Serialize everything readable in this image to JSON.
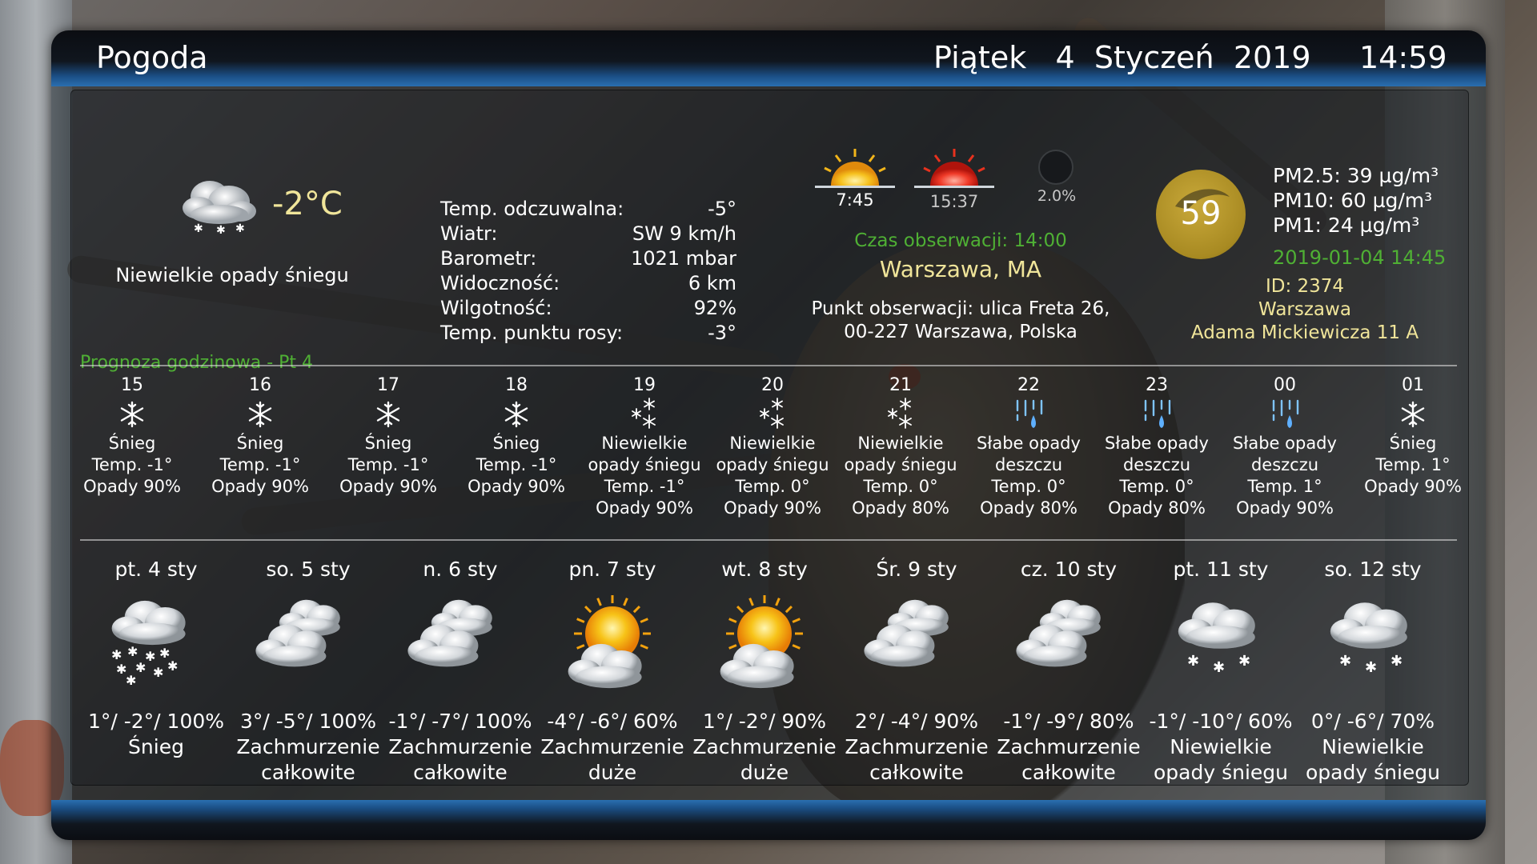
{
  "header": {
    "title": "Pogoda",
    "weekday": "Piątek",
    "day": "4",
    "month": "Styczeń",
    "year": "2019",
    "time": "14:59"
  },
  "current": {
    "icon": "snow-cloud-icon",
    "temperature": "-2°C",
    "description": "Niewielkie opady śniegu",
    "details": [
      {
        "label": "Temp. odczuwalna:",
        "value": "-5°"
      },
      {
        "label": "Wiatr:",
        "value": "SW 9 km/h"
      },
      {
        "label": "Barometr:",
        "value": "1021 mbar"
      },
      {
        "label": "Widoczność:",
        "value": "6 km"
      },
      {
        "label": "Wilgotność:",
        "value": "92%"
      },
      {
        "label": "Temp. punktu rosy:",
        "value": "-3°"
      }
    ]
  },
  "sun_moon": {
    "sunrise": "7:45",
    "sunset": "15:37",
    "moon": "2.0%"
  },
  "observation": {
    "time": "Czas obserwacji: 14:00",
    "city": "Warszawa, MA",
    "point_line1": "Punkt obserwacji: ulica Freta 26,",
    "point_line2": "00-227 Warszawa, Polska"
  },
  "air_quality": {
    "aqi": "59",
    "pm25": "PM2.5: 39 µg/m³",
    "pm10": "PM10: 60 µg/m³",
    "pm1": "PM1: 24 µg/m³",
    "updated": "2019-01-04  14:45",
    "station_id": "ID: 2374",
    "station_city": "Warszawa",
    "station_address": "Adama Mickiewicza 11 A",
    "accent_color": "#b8982a"
  },
  "hourly": {
    "title": "Prognoza godzinowa - Pt 4",
    "items": [
      {
        "hour": "15",
        "icon": "snowflake-icon",
        "desc": "Śnieg",
        "temp": "Temp. -1°",
        "precip": "Opady 90%"
      },
      {
        "hour": "16",
        "icon": "snowflake-icon",
        "desc": "Śnieg",
        "temp": "Temp. -1°",
        "precip": "Opady 90%"
      },
      {
        "hour": "17",
        "icon": "snowflake-icon",
        "desc": "Śnieg",
        "temp": "Temp. -1°",
        "precip": "Opady 90%"
      },
      {
        "hour": "18",
        "icon": "snowflake-icon",
        "desc": "Śnieg",
        "temp": "Temp. -1°",
        "precip": "Opady 90%"
      },
      {
        "hour": "19",
        "icon": "light-snow-icon",
        "desc": "Niewielkie opady śniegu",
        "temp": "Temp. -1°",
        "precip": "Opady 90%"
      },
      {
        "hour": "20",
        "icon": "light-snow-icon",
        "desc": "Niewielkie opady śniegu",
        "temp": "Temp. 0°",
        "precip": "Opady 90%"
      },
      {
        "hour": "21",
        "icon": "light-snow-icon",
        "desc": "Niewielkie opady śniegu",
        "temp": "Temp. 0°",
        "precip": "Opady 80%"
      },
      {
        "hour": "22",
        "icon": "rain-icon",
        "desc": "Słabe opady deszczu",
        "temp": "Temp. 0°",
        "precip": "Opady 80%"
      },
      {
        "hour": "23",
        "icon": "rain-icon",
        "desc": "Słabe opady deszczu",
        "temp": "Temp. 0°",
        "precip": "Opady 80%"
      },
      {
        "hour": "00",
        "icon": "rain-icon",
        "desc": "Słabe opady deszczu",
        "temp": "Temp. 1°",
        "precip": "Opady 90%"
      },
      {
        "hour": "01",
        "icon": "snowflake-icon",
        "desc": "Śnieg",
        "temp": "Temp. 1°",
        "precip": "Opady 90%"
      }
    ]
  },
  "daily": [
    {
      "day": "pt. 4 sty",
      "icon": "snow-cloud-icon",
      "temps": "1°/ -2°/ 100%",
      "desc1": "Śnieg",
      "desc2": ""
    },
    {
      "day": "so. 5 sty",
      "icon": "overcast-icon",
      "temps": "3°/ -5°/ 100%",
      "desc1": "Zachmurzenie",
      "desc2": "całkowite"
    },
    {
      "day": "n. 6 sty",
      "icon": "overcast-icon",
      "temps": "-1°/ -7°/ 100%",
      "desc1": "Zachmurzenie",
      "desc2": "całkowite"
    },
    {
      "day": "pn. 7 sty",
      "icon": "partly-sunny-icon",
      "temps": "-4°/ -6°/ 60%",
      "desc1": "Zachmurzenie",
      "desc2": "duże"
    },
    {
      "day": "wt. 8 sty",
      "icon": "partly-sunny-icon",
      "temps": "1°/ -2°/ 90%",
      "desc1": "Zachmurzenie",
      "desc2": "duże"
    },
    {
      "day": "Śr. 9 sty",
      "icon": "overcast-icon",
      "temps": "2°/ -4°/ 90%",
      "desc1": "Zachmurzenie",
      "desc2": "całkowite"
    },
    {
      "day": "cz. 10 sty",
      "icon": "overcast-icon",
      "temps": "-1°/ -9°/ 80%",
      "desc1": "Zachmurzenie",
      "desc2": "całkowite"
    },
    {
      "day": "pt. 11 sty",
      "icon": "light-snow-cloud-icon",
      "temps": "-1°/ -10°/ 60%",
      "desc1": "Niewielkie",
      "desc2": "opady śniegu"
    },
    {
      "day": "so. 12 sty",
      "icon": "light-snow-cloud-icon",
      "temps": "0°/ -6°/ 70%",
      "desc1": "Niewielkie",
      "desc2": "opady śniegu"
    }
  ],
  "colors": {
    "accent_yellow": "#f0e59a",
    "accent_green": "#4fb034",
    "bar_blue": "#2a6fb0"
  }
}
